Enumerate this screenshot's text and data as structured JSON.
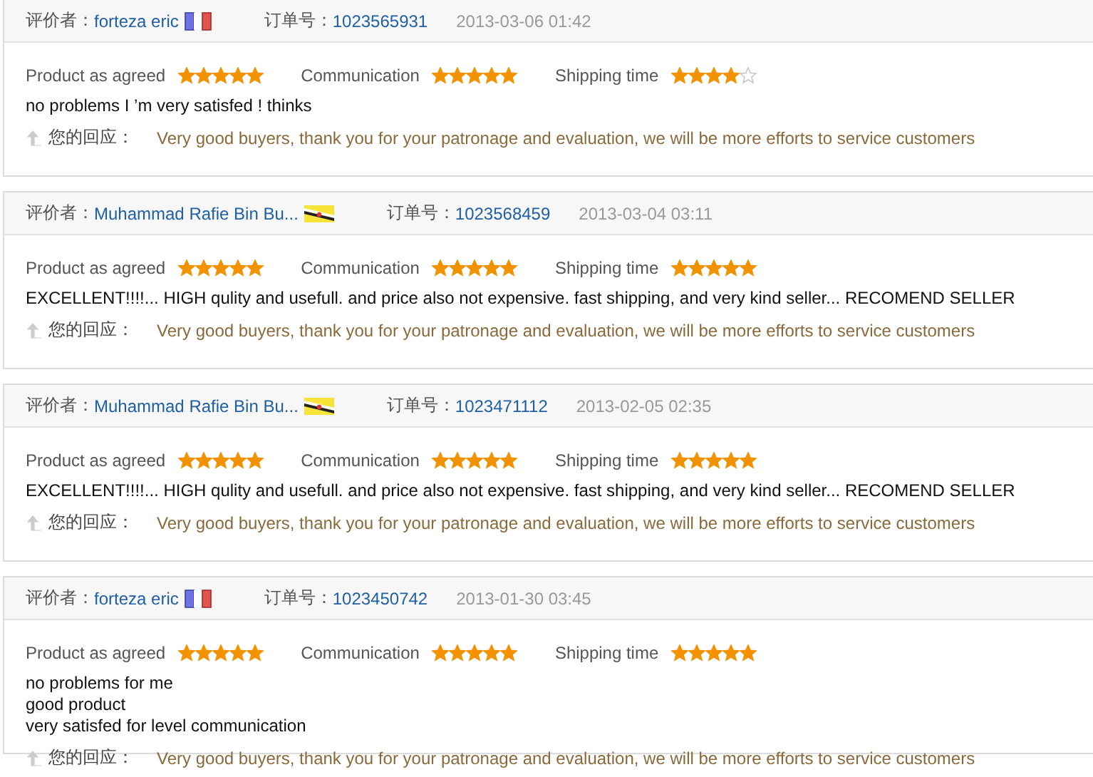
{
  "reviews": [
    {
      "reviewer_label": "评价者：",
      "reviewer": "forteza eric",
      "flag": {
        "kind": "tricolor"
      },
      "order_label": "订单号：",
      "order_no": "1023565931",
      "date": "2013-03-06 01:42",
      "ratings": [
        {
          "label": "Product as agreed",
          "stars": 5
        },
        {
          "label": "Communication",
          "stars": 5
        },
        {
          "label": "Shipping time",
          "stars": 4
        }
      ],
      "comment": [
        "no problems I ’m very satisfed ! thinks"
      ],
      "reply_label": "您的回应：",
      "reply": "Very good buyers, thank you for your patronage and evaluation, we will be more efforts to service customers"
    },
    {
      "reviewer_label": "评价者：",
      "reviewer": "Muhammad Rafie Bin Bu...",
      "flag": {
        "kind": "diagonal"
      },
      "order_label": "订单号：",
      "order_no": "1023568459",
      "date": "2013-03-04 03:11",
      "ratings": [
        {
          "label": "Product as agreed",
          "stars": 5
        },
        {
          "label": "Communication",
          "stars": 5
        },
        {
          "label": "Shipping time",
          "stars": 5
        }
      ],
      "comment": [
        "EXCELLENT!!!!... HIGH qulity and usefull. and price also not expensive. fast shipping, and very kind seller... RECOMEND SELLER"
      ],
      "reply_label": "您的回应：",
      "reply": "Very good buyers, thank you for your patronage and evaluation, we will be more efforts to service customers"
    },
    {
      "reviewer_label": "评价者：",
      "reviewer": "Muhammad Rafie Bin Bu...",
      "flag": {
        "kind": "diagonal"
      },
      "order_label": "订单号：",
      "order_no": "1023471112",
      "date": "2013-02-05 02:35",
      "ratings": [
        {
          "label": "Product as agreed",
          "stars": 5
        },
        {
          "label": "Communication",
          "stars": 5
        },
        {
          "label": "Shipping time",
          "stars": 5
        }
      ],
      "comment": [
        "EXCELLENT!!!!... HIGH qulity and usefull. and price also not expensive. fast shipping, and very kind seller... RECOMEND SELLER"
      ],
      "reply_label": "您的回应：",
      "reply": "Very good buyers, thank you for your patronage and evaluation, we will be more efforts to service customers"
    },
    {
      "reviewer_label": "评价者：",
      "reviewer": "forteza eric",
      "flag": {
        "kind": "tricolor"
      },
      "order_label": "订单号：",
      "order_no": "1023450742",
      "date": "2013-01-30 03:45",
      "ratings": [
        {
          "label": "Product as agreed",
          "stars": 5
        },
        {
          "label": "Communication",
          "stars": 5
        },
        {
          "label": "Shipping time",
          "stars": 5
        }
      ],
      "comment": [
        "no problems for me",
        "good product",
        "very satisfed for level communication"
      ],
      "reply_label": "您的回应：",
      "reply": "Very good buyers, thank you for your patronage and evaluation, we will be more efforts to service customers"
    }
  ]
}
